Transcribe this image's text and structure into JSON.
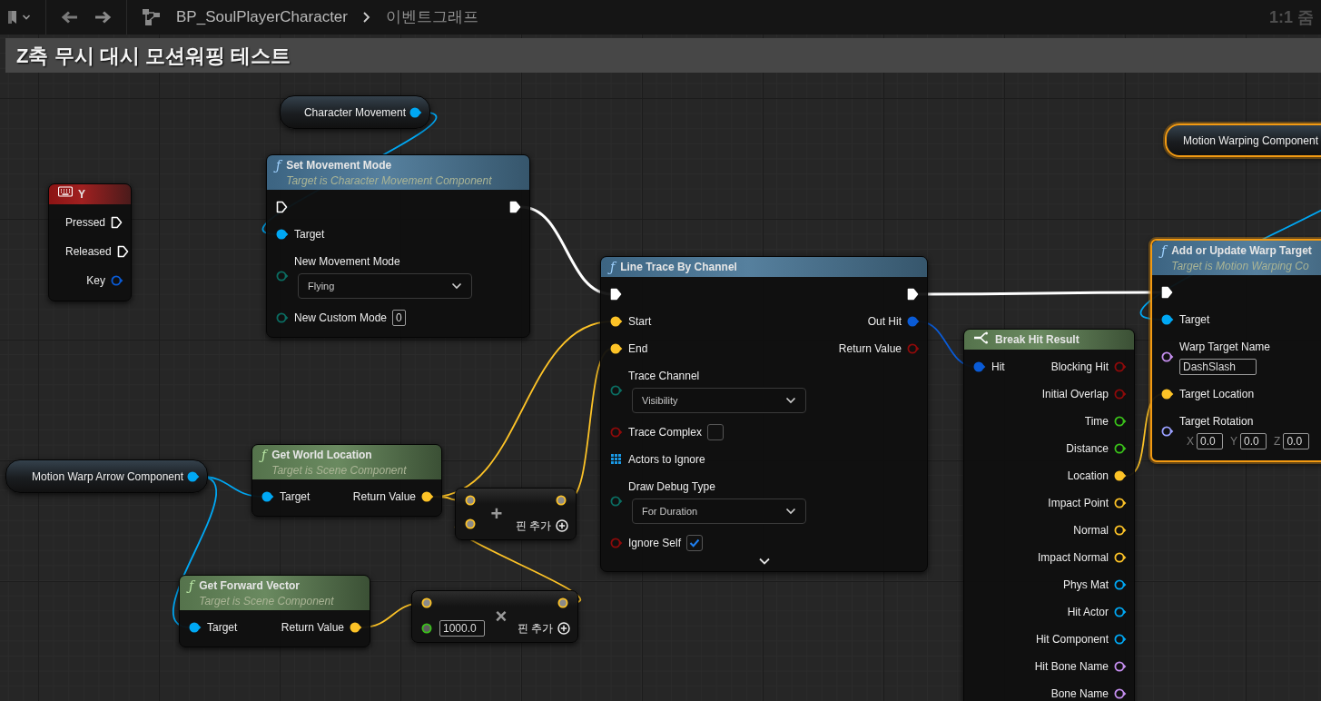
{
  "toolbar": {
    "asset": "BP_SoulPlayerCharacter",
    "graph": "이벤트그래프",
    "zoom": "1:1 줌"
  },
  "comment": {
    "title": "Z축 무시 대시 모션워핑 테스트"
  },
  "nodes": [
    {
      "kind": "variable",
      "label": "Character Movement",
      "selected": false,
      "rows": [
        {
          "out": {
            "kind": "object",
            "connected": true
          }
        }
      ]
    },
    {
      "kind": "event",
      "title": "Y",
      "selected": false,
      "rows": [
        {
          "out": {
            "label": "Pressed",
            "kind": "exec",
            "connected": false
          }
        },
        {
          "out": {
            "label": "Released",
            "kind": "exec",
            "connected": false
          }
        },
        {
          "out": {
            "label": "Key",
            "kind": "struct",
            "connected": false
          }
        }
      ]
    },
    {
      "kind": "function",
      "glyph": "ƒ",
      "title": "Set Movement Mode",
      "subtitle": "Target is Character Movement Component",
      "selected": false,
      "rows": [
        {
          "in": {
            "kind": "exec",
            "connected": false
          },
          "out": {
            "kind": "exec",
            "connected": true
          }
        },
        {
          "in": {
            "label": "Target",
            "kind": "object",
            "connected": true
          }
        },
        {
          "in": {
            "label": "New Movement Mode",
            "kind": "byte",
            "connected": false,
            "widget": {
              "kind": "dropdown",
              "value": "Flying"
            }
          }
        },
        {
          "in": {
            "label": "New Custom Mode",
            "kind": "byte",
            "connected": false,
            "widget": {
              "kind": "number",
              "value": "0"
            }
          }
        }
      ]
    },
    {
      "kind": "function",
      "glyph": "ƒ",
      "title": "Line Trace By Channel",
      "selected": false,
      "has_advanced": true,
      "rows": [
        {
          "in": {
            "kind": "exec",
            "connected": true
          },
          "out": {
            "kind": "exec",
            "connected": true
          }
        },
        {
          "in": {
            "label": "Start",
            "kind": "vector",
            "connected": true
          },
          "out": {
            "label": "Out Hit",
            "kind": "struct",
            "connected": true
          }
        },
        {
          "in": {
            "label": "End",
            "kind": "vector",
            "connected": true
          },
          "out": {
            "label": "Return Value",
            "kind": "bool",
            "connected": false
          }
        },
        {
          "in": {
            "label": "Trace Channel",
            "kind": "byte",
            "connected": false,
            "widget": {
              "kind": "dropdown",
              "value": "Visibility"
            }
          }
        },
        {
          "in": {
            "label": "Trace Complex",
            "kind": "bool",
            "connected": false,
            "widget": {
              "kind": "checkbox",
              "checked": false
            }
          }
        },
        {
          "in": {
            "label": "Actors to Ignore",
            "kind": "array",
            "connected": false
          }
        },
        {
          "in": {
            "label": "Draw Debug Type",
            "kind": "byte",
            "connected": false,
            "widget": {
              "kind": "dropdown",
              "value": "For Duration"
            }
          }
        },
        {
          "in": {
            "label": "Ignore Self",
            "kind": "bool",
            "connected": false,
            "widget": {
              "kind": "checkbox",
              "checked": true
            }
          }
        }
      ]
    },
    {
      "kind": "variable",
      "label": "Motion Warp Arrow Component",
      "selected": false,
      "rows": [
        {
          "out": {
            "kind": "object",
            "connected": true
          }
        }
      ]
    },
    {
      "kind": "pure",
      "glyph": "ƒ",
      "title": "Get World Location",
      "subtitle": "Target is Scene Component",
      "selected": false,
      "rows": [
        {
          "in": {
            "label": "Target",
            "kind": "object",
            "connected": true
          },
          "out": {
            "label": "Return Value",
            "kind": "vector",
            "connected": true
          }
        }
      ]
    },
    {
      "kind": "math",
      "symbol": "+",
      "add_pin": "핀 추가",
      "selected": false,
      "rows": [
        {
          "in": {
            "kind": "vector",
            "connected": true
          },
          "out": {
            "kind": "vector",
            "connected": true
          }
        },
        {
          "in": {
            "kind": "vector",
            "connected": true
          }
        }
      ]
    },
    {
      "kind": "pure",
      "glyph": "ƒ",
      "title": "Get Forward Vector",
      "subtitle": "Target is Scene Component",
      "selected": false,
      "rows": [
        {
          "in": {
            "label": "Target",
            "kind": "object",
            "connected": true
          },
          "out": {
            "label": "Return Value",
            "kind": "vector",
            "connected": true
          }
        }
      ]
    },
    {
      "kind": "math",
      "symbol": "×",
      "add_pin": "핀 추가",
      "selected": false,
      "rows": [
        {
          "in": {
            "kind": "vector",
            "connected": true
          },
          "out": {
            "kind": "vector",
            "connected": true
          }
        },
        {
          "in": {
            "kind": "float",
            "connected": false,
            "widget": {
              "kind": "number",
              "value": "1000.0"
            }
          }
        }
      ]
    },
    {
      "kind": "break",
      "title": "Break Hit Result",
      "selected": false,
      "rows": [
        {
          "in": {
            "label": "Hit",
            "kind": "struct",
            "connected": true
          },
          "out": {
            "label": "Blocking Hit",
            "kind": "bool",
            "connected": false
          }
        },
        {
          "out": {
            "label": "Initial Overlap",
            "kind": "bool",
            "connected": false
          }
        },
        {
          "out": {
            "label": "Time",
            "kind": "float",
            "connected": false
          }
        },
        {
          "out": {
            "label": "Distance",
            "kind": "float",
            "connected": false
          }
        },
        {
          "out": {
            "label": "Location",
            "kind": "vector",
            "connected": true
          }
        },
        {
          "out": {
            "label": "Impact Point",
            "kind": "vector",
            "connected": false
          }
        },
        {
          "out": {
            "label": "Normal",
            "kind": "vector",
            "connected": false
          }
        },
        {
          "out": {
            "label": "Impact Normal",
            "kind": "vector",
            "connected": false
          }
        },
        {
          "out": {
            "label": "Phys Mat",
            "kind": "object",
            "connected": false
          }
        },
        {
          "out": {
            "label": "Hit Actor",
            "kind": "object",
            "connected": false
          }
        },
        {
          "out": {
            "label": "Hit Component",
            "kind": "object",
            "connected": false
          }
        },
        {
          "out": {
            "label": "Hit Bone Name",
            "kind": "name",
            "connected": false
          }
        },
        {
          "out": {
            "label": "Bone Name",
            "kind": "name",
            "connected": false
          }
        }
      ]
    },
    {
      "kind": "variable",
      "label": "Motion Warping Component",
      "selected": true
    },
    {
      "kind": "function",
      "glyph": "ƒ",
      "title": "Add or Update Warp Target",
      "subtitle": "Target is Motion Warping Co",
      "selected": true,
      "rows": [
        {
          "in": {
            "kind": "exec",
            "connected": true
          }
        },
        {
          "in": {
            "label": "Target",
            "kind": "object",
            "connected": true
          }
        },
        {
          "in": {
            "label": "Warp Target Name",
            "kind": "name",
            "connected": false,
            "widget": {
              "kind": "text",
              "value": "DashSlash"
            }
          }
        },
        {
          "in": {
            "label": "Target Location",
            "kind": "vector",
            "connected": true
          }
        },
        {
          "in": {
            "label": "Target Rotation",
            "kind": "rotator",
            "connected": false,
            "widget": {
              "kind": "vector",
              "fields": [
                {
                  "axis": "X",
                  "value": "0.0"
                },
                {
                  "axis": "Y",
                  "value": "0.0"
                },
                {
                  "axis": "Z",
                  "value": "0.0"
                }
              ]
            }
          }
        }
      ]
    }
  ]
}
